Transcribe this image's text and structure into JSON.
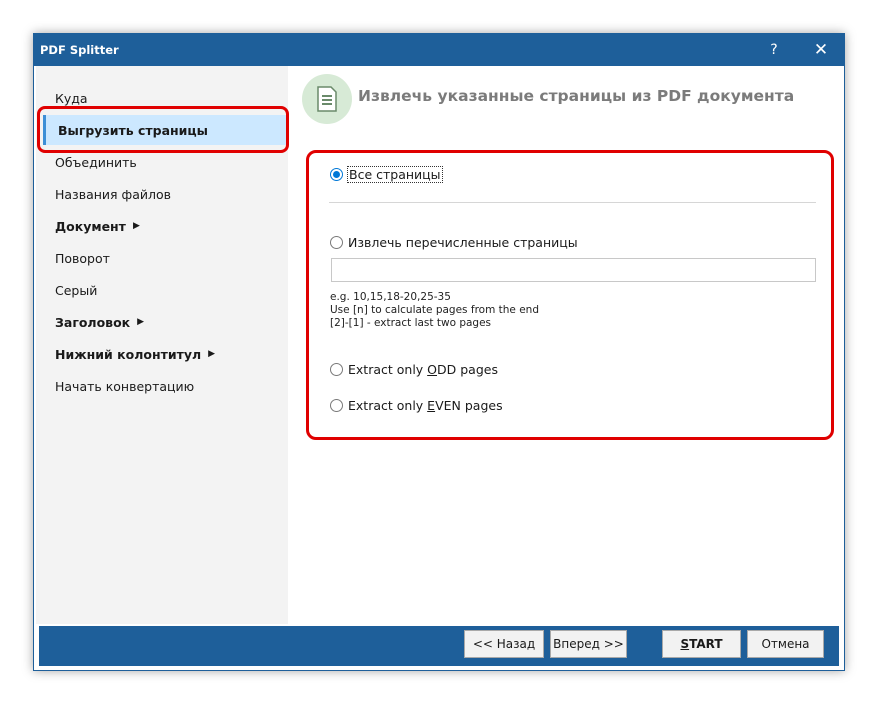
{
  "window": {
    "title": "PDF Splitter",
    "help_label": "?",
    "close_label": "✕"
  },
  "sidebar": {
    "items": [
      {
        "label": "Куда",
        "bold": false,
        "selected": false,
        "has_arrow": false
      },
      {
        "label": "Выгрузить страницы",
        "bold": true,
        "selected": true,
        "has_arrow": false
      },
      {
        "label": "Объединить",
        "bold": false,
        "selected": false,
        "has_arrow": false
      },
      {
        "label": "Названия файлов",
        "bold": false,
        "selected": false,
        "has_arrow": false
      },
      {
        "label": "Документ",
        "bold": true,
        "selected": false,
        "has_arrow": true
      },
      {
        "label": "Поворот",
        "bold": false,
        "selected": false,
        "has_arrow": false
      },
      {
        "label": "Серый",
        "bold": false,
        "selected": false,
        "has_arrow": false
      },
      {
        "label": "Заголовок",
        "bold": true,
        "selected": false,
        "has_arrow": true
      },
      {
        "label": "Нижний колонтитул",
        "bold": true,
        "selected": false,
        "has_arrow": true
      },
      {
        "label": "Начать конвертацию",
        "bold": false,
        "selected": false,
        "has_arrow": false
      }
    ]
  },
  "main": {
    "heading": "Извлечь указанные страницы из PDF документа",
    "options": {
      "all_pages": {
        "label": "Все страницы",
        "checked": true
      },
      "listed_pages": {
        "label": "Извлечь перечисленные страницы",
        "checked": false
      },
      "odd_pages": {
        "prefix": "Extract only ",
        "accel": "O",
        "suffix": "DD pages",
        "checked": false
      },
      "even_pages": {
        "prefix": "Extract only ",
        "accel": "E",
        "suffix": "VEN pages",
        "checked": false
      }
    },
    "pages_input": {
      "value": "",
      "placeholder": ""
    },
    "hints": [
      "e.g. 10,15,18-20,25-35",
      "Use [n] to calculate pages from the end",
      "[2]-[1] - extract last two pages"
    ]
  },
  "footer": {
    "back_label": "<< Назад",
    "next_label": "Вперед >>",
    "start_accel": "S",
    "start_rest": "TART",
    "cancel_label": "Отмена"
  },
  "colors": {
    "titlebar": "#1e5f9a",
    "selection": "#cce8ff",
    "highlight": "#e00000",
    "icon_bg": "#d7ead6",
    "icon_fg": "#6a8a6a"
  },
  "icons": {
    "header": "document-icon",
    "arrow": "triangle-right-icon"
  }
}
